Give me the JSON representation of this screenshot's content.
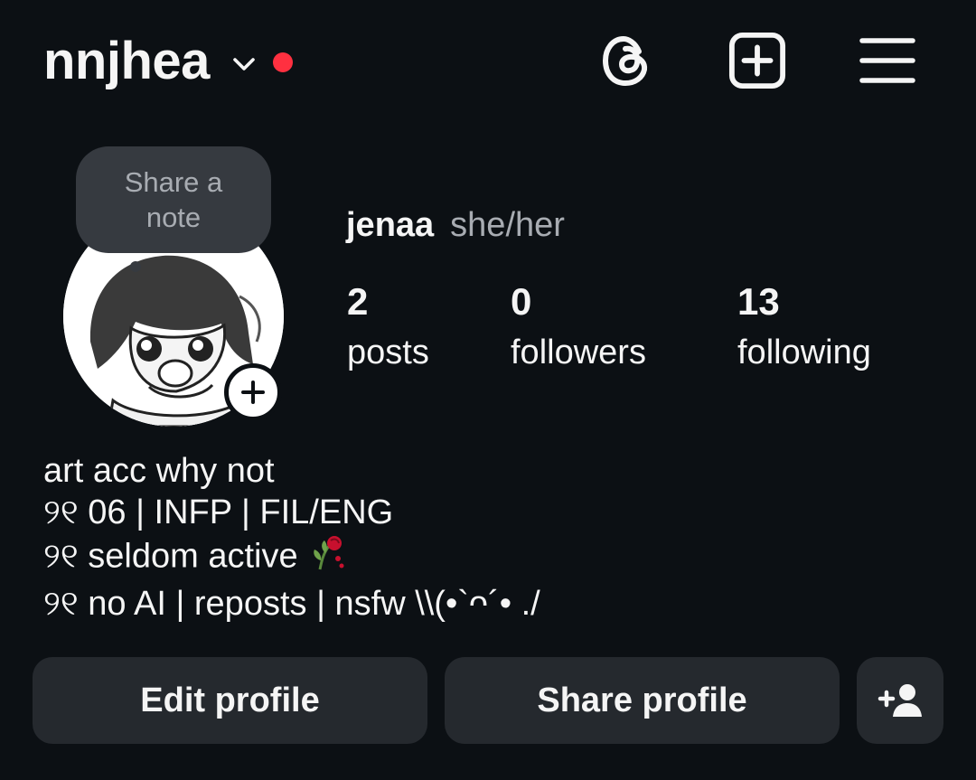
{
  "header": {
    "username": "nnjhea",
    "icons": [
      "chevron-down-icon",
      "notification-dot",
      "threads-icon",
      "create-post-icon",
      "menu-icon"
    ],
    "dot_color": "#ff3040"
  },
  "profile": {
    "note_placeholder": "Share a note",
    "avatar": "avatar",
    "display_name": "jenaa",
    "pronouns": "she/her",
    "stats": [
      {
        "value": "2",
        "label": "posts"
      },
      {
        "value": "0",
        "label": "followers"
      },
      {
        "value": "13",
        "label": "following"
      }
    ]
  },
  "bio": {
    "lines": [
      "art acc why not",
      "୨୧ 06 | INFP | FIL/ENG",
      "୨୧ seldom active",
      "୨୧ no AI | reposts | nsfw \\\\(•`ᴖ´• ./"
    ],
    "emoji": "wilted-rose-icon"
  },
  "actions": {
    "edit_label": "Edit profile",
    "share_label": "Share profile",
    "add_person_icon": "add-person-icon"
  },
  "colors": {
    "background": "#0c1014",
    "button": "#25292e",
    "muted_text": "#a8acb2"
  }
}
